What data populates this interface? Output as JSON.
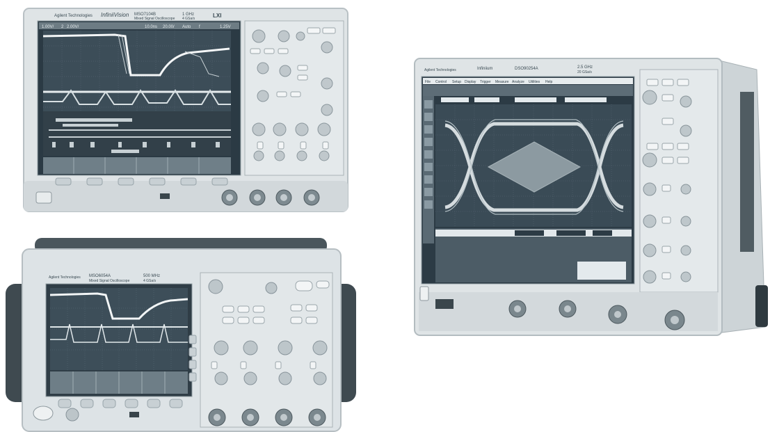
{
  "scope_top_left": {
    "brand": "Agilent Technologies",
    "series": "InfiniiVision",
    "model": "MSO7104B",
    "model_sub": "Mixed Signal Oscilloscope",
    "bandwidth": "1 GHz",
    "sample_rate": "4 GSa/s",
    "lxi": "LXI",
    "status_bar": [
      "1.00V/",
      "2",
      "2.00V/",
      "10.0ns",
      "20.00/",
      "Auto",
      "f",
      "1.25V"
    ]
  },
  "scope_bottom_left": {
    "brand": "Agilent Technologies",
    "model": "MSO6054A",
    "model_sub": "Mixed Signal Oscilloscope",
    "bandwidth": "500 MHz",
    "sample_rate": "4 GSa/s"
  },
  "scope_right": {
    "brand": "Agilent Technologies",
    "series": "Infiniium",
    "model": "DSO90254A",
    "bandwidth": "2.5 GHz",
    "sample_rate": "20 GSa/s",
    "menu": [
      "File",
      "Control",
      "Setup",
      "Display",
      "Trigger",
      "Measure",
      "Analyze",
      "Utilities",
      "Help"
    ]
  }
}
